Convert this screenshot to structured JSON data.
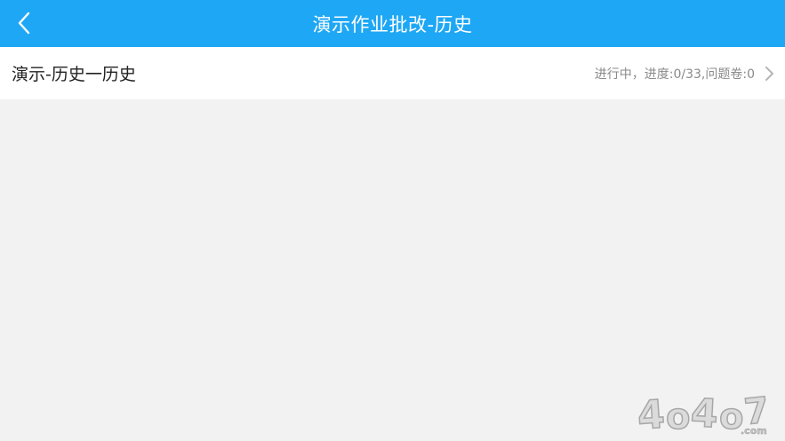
{
  "header": {
    "back_icon": "chevron-left-icon",
    "title": "演示作业批改-历史"
  },
  "list": {
    "items": [
      {
        "title": "演示-历史一历史",
        "status": "进行中，进度:0/33,问题卷:0",
        "chevron_icon": "chevron-right-icon"
      }
    ]
  },
  "watermark": {
    "text": "4o4o7.com"
  },
  "colors": {
    "header_bg": "#1ea7f5",
    "page_bg": "#f2f2f2",
    "text_primary": "#222222",
    "text_secondary": "#8a8a8a"
  }
}
